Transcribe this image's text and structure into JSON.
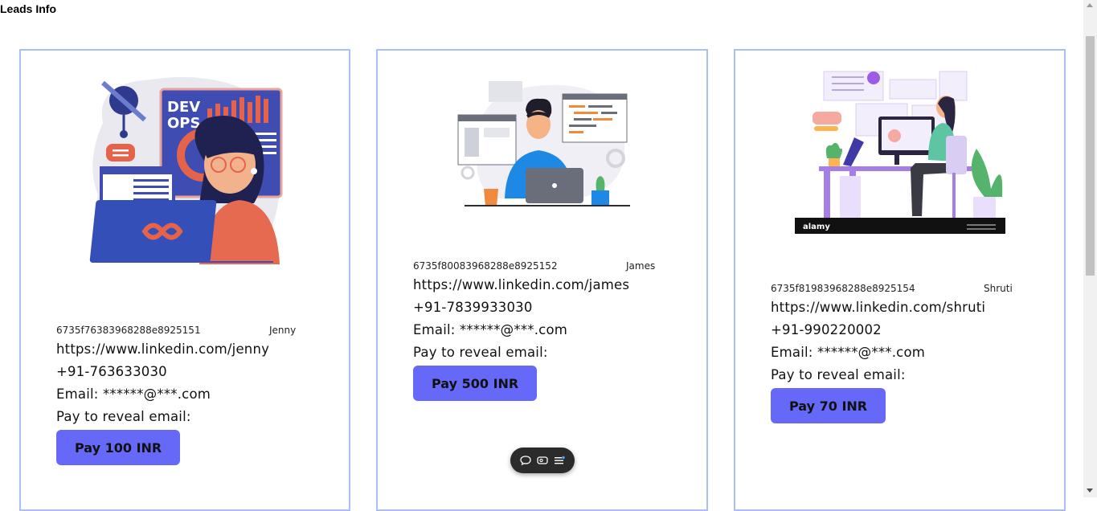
{
  "page": {
    "title": "Leads Info"
  },
  "leads": [
    {
      "id": "6735f76383968288e8925151",
      "name": "Jenny",
      "linkedin": "https://www.linkedin.com/jenny",
      "phone": "+91-763633030",
      "email": "Email: ******@***.com",
      "reveal_label": "Pay to reveal email:",
      "pay_label": "Pay 100 INR",
      "illustration": {
        "heading": "DEV\nOPS",
        "icon": "devops-woman-illustration"
      }
    },
    {
      "id": "6735f80083968288e8925152",
      "name": "James",
      "linkedin": "https://www.linkedin.com/james",
      "phone": "+91-7839933030",
      "email": "Email: ******@***.com",
      "reveal_label": "Pay to reveal email:",
      "pay_label": "Pay 500 INR",
      "illustration": {
        "icon": "developer-laptop-illustration"
      }
    },
    {
      "id": "6735f81983968288e8925154",
      "name": "Shruti",
      "linkedin": "https://www.linkedin.com/shruti",
      "phone": "+91-990220002",
      "email": "Email: ******@***.com",
      "reveal_label": "Pay to reveal email:",
      "pay_label": "Pay 70 INR",
      "illustration": {
        "icon": "woman-at-desk-illustration",
        "watermark": "alamy"
      }
    }
  ],
  "toolbar": {
    "icons": [
      "chat-icon",
      "caption-icon",
      "menu-icon"
    ]
  },
  "colors": {
    "card_border": "#a9bff5",
    "button": "#6669f7",
    "purple": "#9b5de5"
  }
}
